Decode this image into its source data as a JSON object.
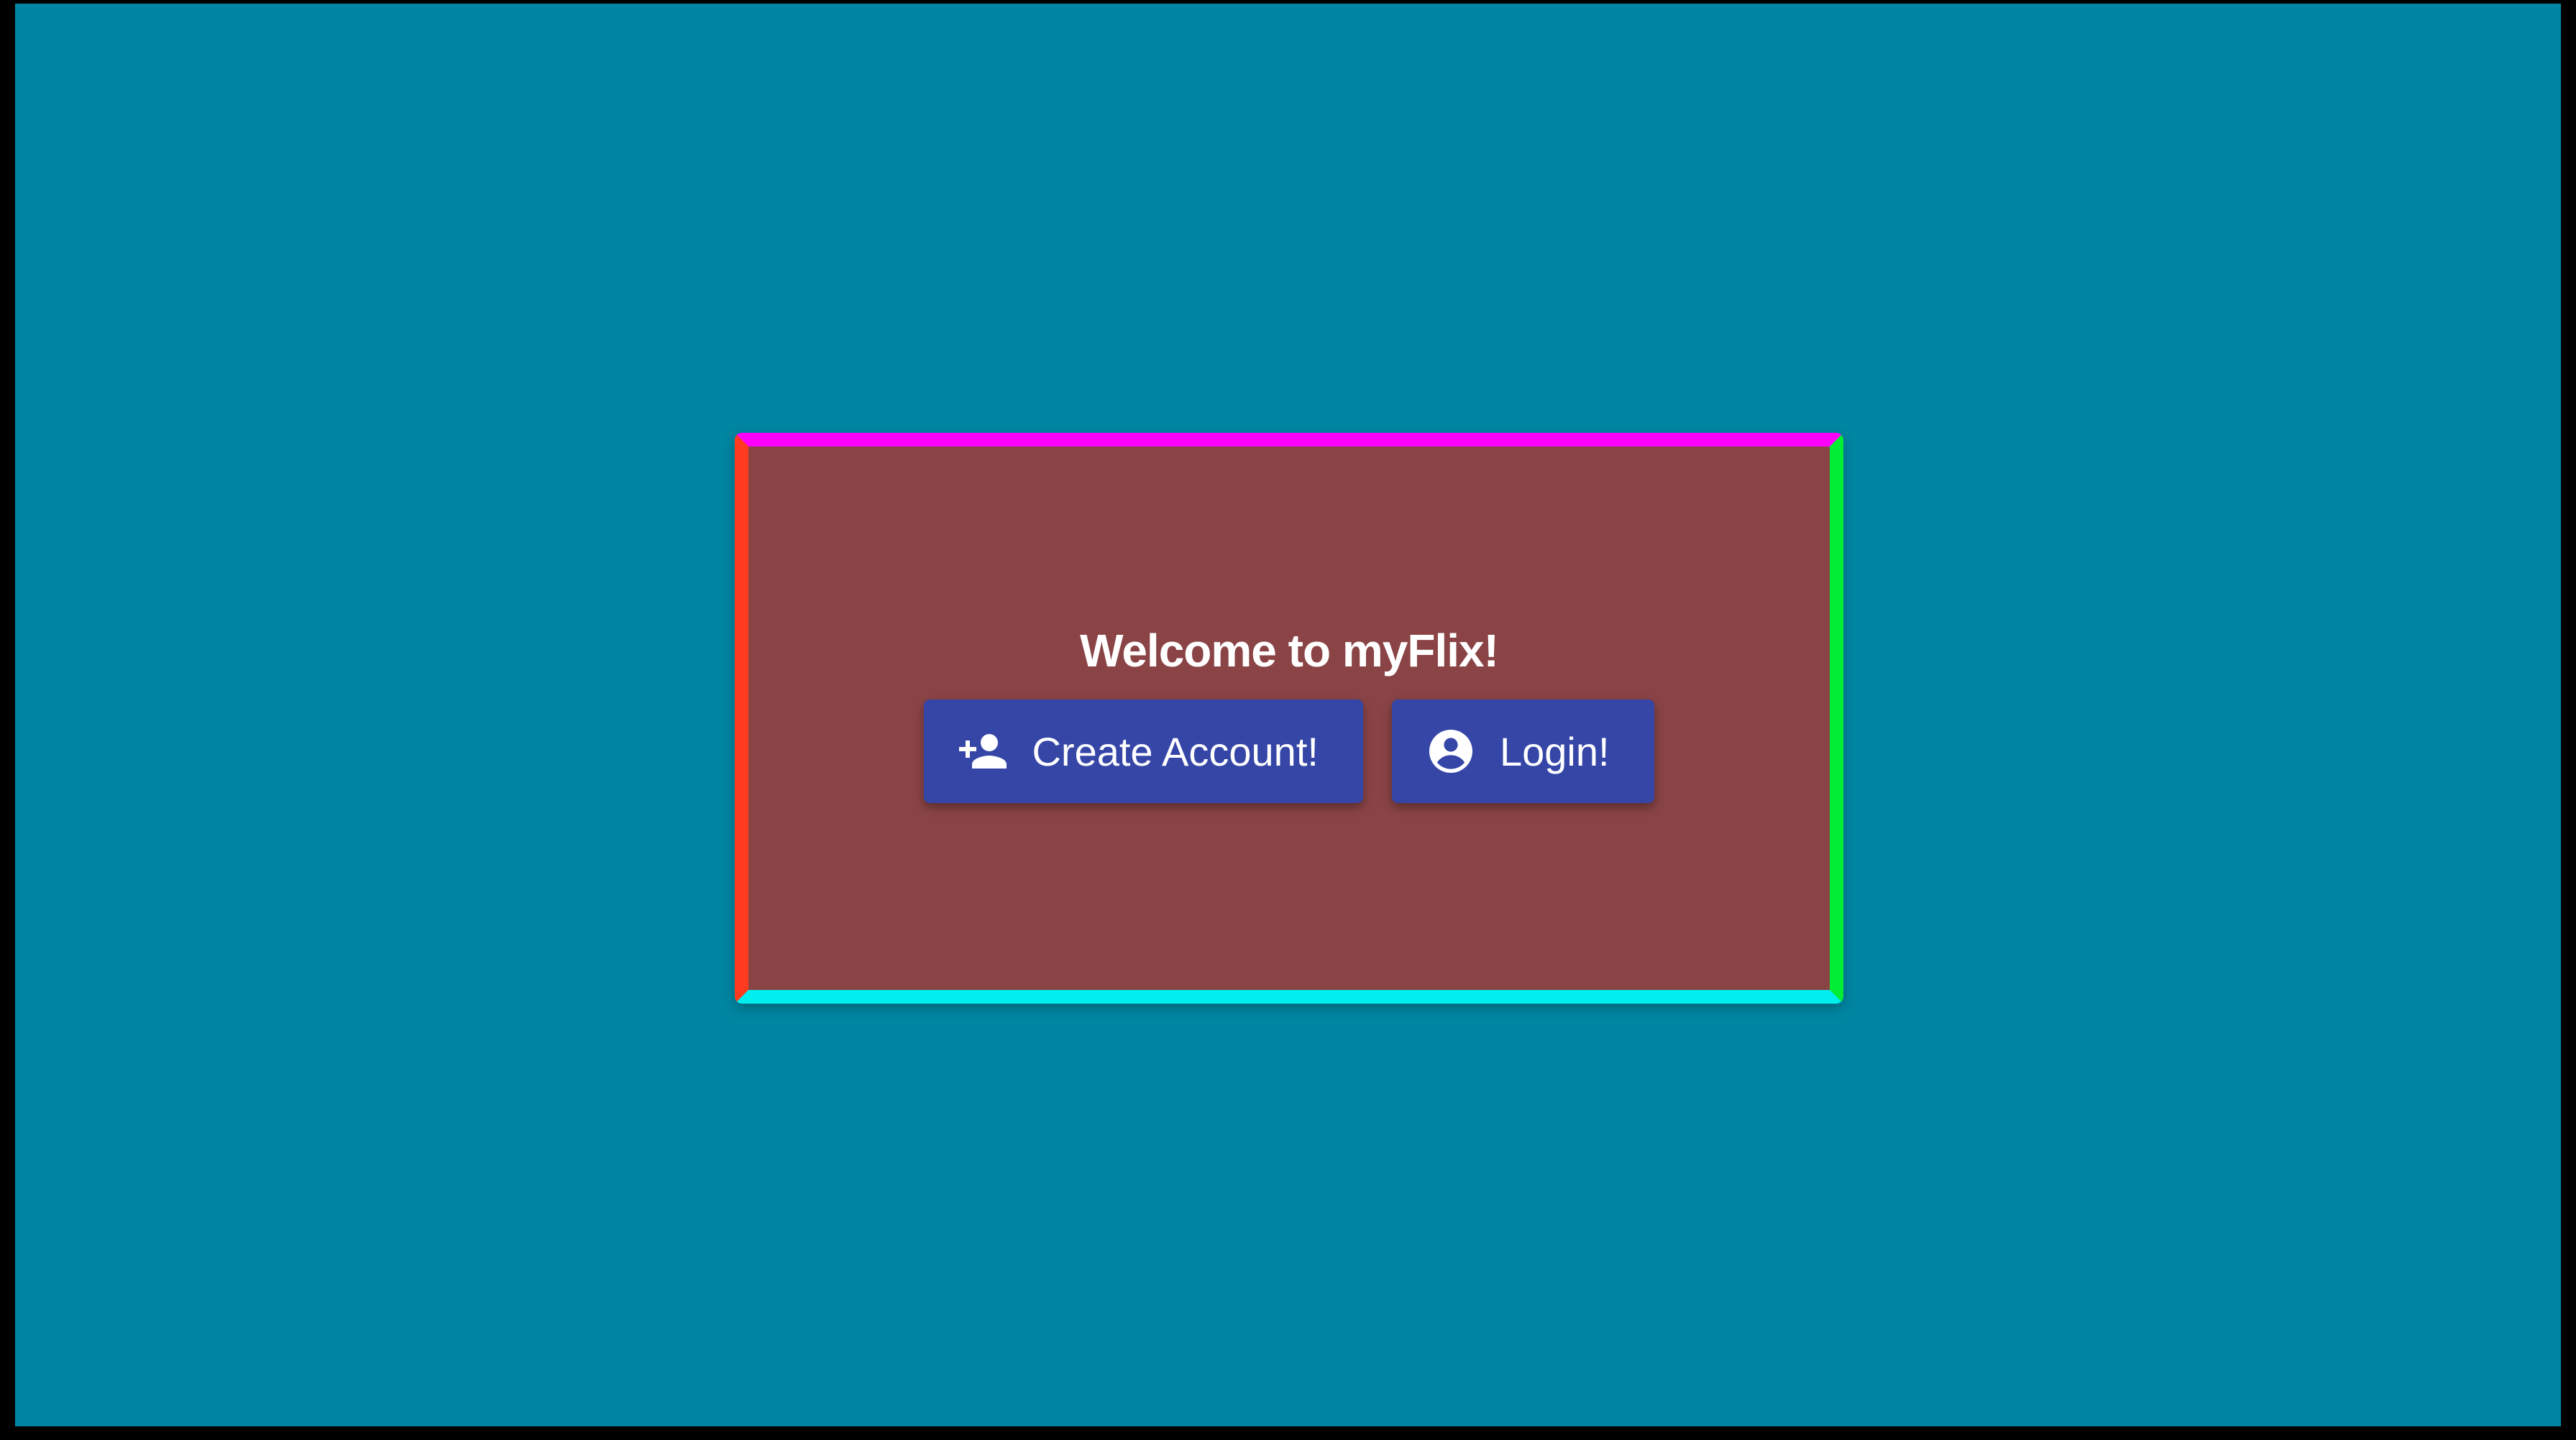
{
  "page": {
    "background_color": "#0086a2",
    "frame_color": "#000000"
  },
  "card": {
    "background_color": "#8a4446",
    "border_colors": {
      "top": "#ff00ff",
      "right": "#00ee33",
      "bottom": "#00eeee",
      "left": "#ff3b1f"
    },
    "title": "Welcome to myFlix!"
  },
  "actions": {
    "button_color": "#3546a7",
    "create_account": {
      "label": "Create Account!",
      "icon": "person-add-icon"
    },
    "login": {
      "label": "Login!",
      "icon": "account-circle-icon"
    }
  }
}
